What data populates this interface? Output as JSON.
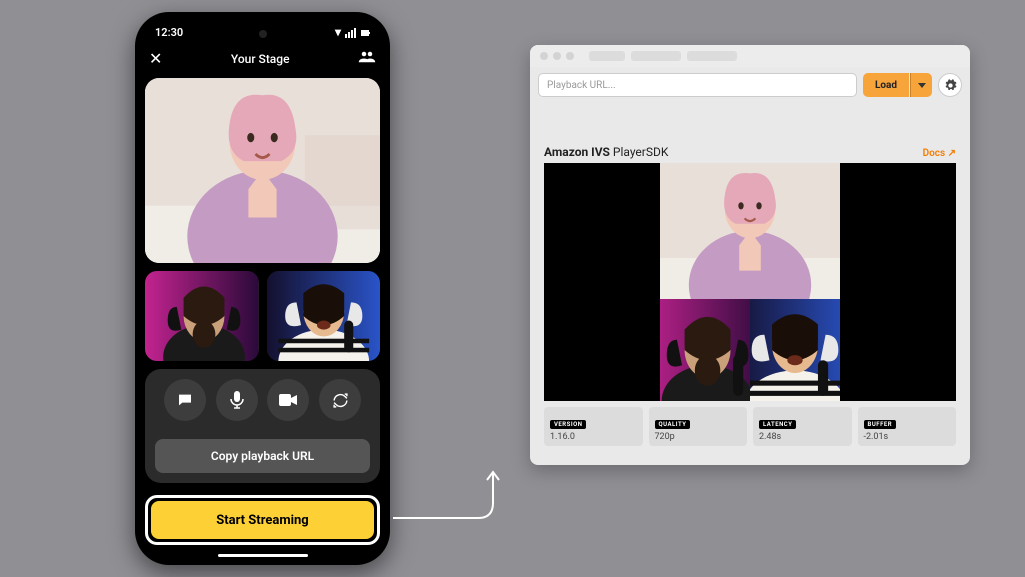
{
  "phone": {
    "status_time": "12:30",
    "title": "Your Stage",
    "controls": {
      "chat_icon": "chat-icon",
      "mic_icon": "mic-icon",
      "video_icon": "video-icon",
      "refresh_icon": "refresh-icon"
    },
    "copy_btn": "Copy playback URL",
    "start_btn": "Start Streaming"
  },
  "browser": {
    "url_placeholder": "Playback URL...",
    "load_btn": "Load",
    "title_bold": "Amazon IVS",
    "title_light": "PlayerSDK",
    "docs_link": "Docs ↗",
    "metrics": [
      {
        "label": "VERSION",
        "value": "1.16.0"
      },
      {
        "label": "QUALITY",
        "value": "720p"
      },
      {
        "label": "LATENCY",
        "value": "2.48s"
      },
      {
        "label": "BUFFER",
        "value": "-2.01s"
      }
    ]
  },
  "colors": {
    "accent_yellow": "#fdd035",
    "accent_orange": "#f7a43b"
  }
}
